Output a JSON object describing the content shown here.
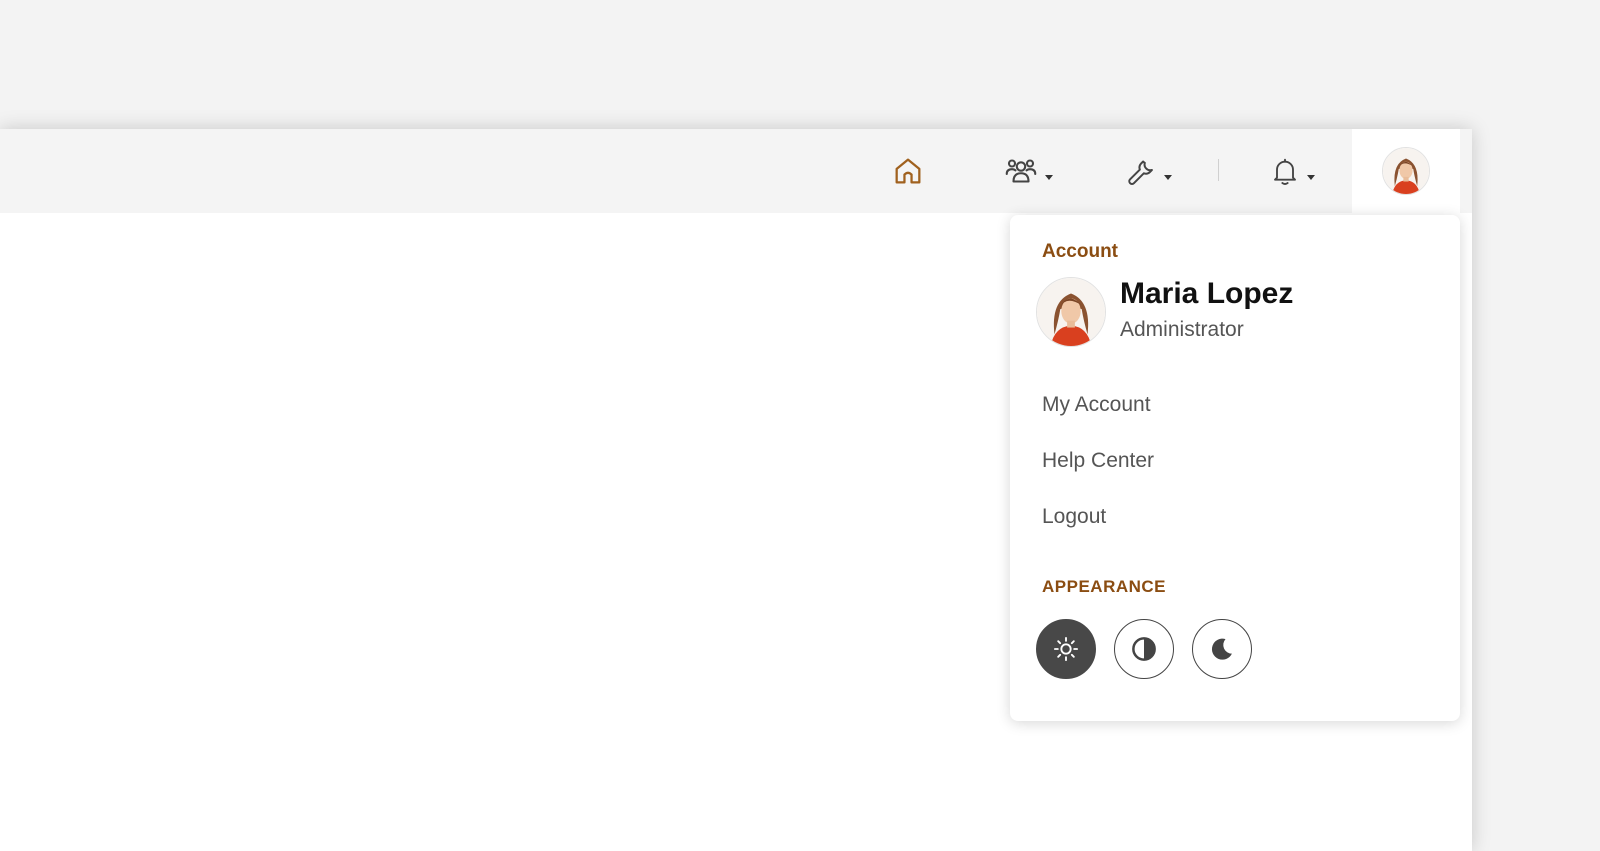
{
  "topbar": {
    "nav": [
      {
        "name": "home",
        "icon": "home-icon"
      },
      {
        "name": "users",
        "icon": "users-icon",
        "has_dropdown": true
      },
      {
        "name": "tools",
        "icon": "wrench-icon",
        "has_dropdown": true
      },
      {
        "name": "notifications",
        "icon": "bell-icon",
        "has_dropdown": true
      }
    ],
    "avatar_icon": "user-avatar"
  },
  "dropdown": {
    "account_title": "Account",
    "user": {
      "name": "Maria Lopez",
      "role": "Administrator"
    },
    "menu": [
      {
        "label": "My Account"
      },
      {
        "label": "Help Center"
      },
      {
        "label": "Logout"
      }
    ],
    "appearance_title": "APPEARANCE",
    "themes": [
      {
        "icon": "sun-icon",
        "active": true
      },
      {
        "icon": "contrast-icon",
        "active": false
      },
      {
        "icon": "moon-icon",
        "active": false
      }
    ]
  },
  "colors": {
    "accent": "#8b4d12",
    "home_icon": "#a0611e",
    "active_theme": "#484848",
    "topbar_bg": "#f4f4f4",
    "page_bg": "#f3f3f3"
  }
}
